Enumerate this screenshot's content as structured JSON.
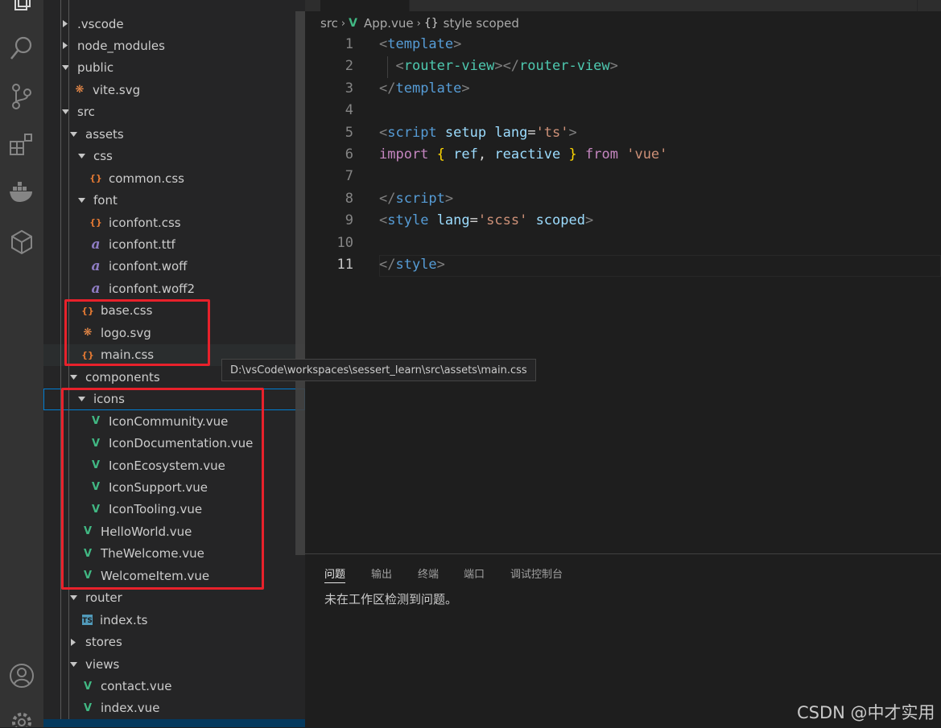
{
  "explorer": {
    "items": [
      {
        "label": ".vscode",
        "kind": "folder",
        "expanded": false,
        "depth": 0
      },
      {
        "label": "node_modules",
        "kind": "folder",
        "expanded": false,
        "depth": 0
      },
      {
        "label": "public",
        "kind": "folder",
        "expanded": true,
        "depth": 0
      },
      {
        "label": "vite.svg",
        "kind": "svg",
        "depth": 1
      },
      {
        "label": "src",
        "kind": "folder",
        "expanded": true,
        "depth": 0
      },
      {
        "label": "assets",
        "kind": "folder",
        "expanded": true,
        "depth": 1
      },
      {
        "label": "css",
        "kind": "folder",
        "expanded": true,
        "depth": 2
      },
      {
        "label": "common.css",
        "kind": "css",
        "depth": 3
      },
      {
        "label": "font",
        "kind": "folder",
        "expanded": true,
        "depth": 2
      },
      {
        "label": "iconfont.css",
        "kind": "css",
        "depth": 3
      },
      {
        "label": "iconfont.ttf",
        "kind": "font",
        "depth": 3
      },
      {
        "label": "iconfont.woff",
        "kind": "font",
        "depth": 3
      },
      {
        "label": "iconfont.woff2",
        "kind": "font",
        "depth": 3
      },
      {
        "label": "base.css",
        "kind": "css",
        "depth": 2
      },
      {
        "label": "logo.svg",
        "kind": "svg",
        "depth": 2
      },
      {
        "label": "main.css",
        "kind": "css",
        "depth": 2
      },
      {
        "label": "components",
        "kind": "folder",
        "expanded": true,
        "depth": 1
      },
      {
        "label": "icons",
        "kind": "folder",
        "expanded": true,
        "depth": 2
      },
      {
        "label": "IconCommunity.vue",
        "kind": "vue",
        "depth": 3
      },
      {
        "label": "IconDocumentation.vue",
        "kind": "vue",
        "depth": 3
      },
      {
        "label": "IconEcosystem.vue",
        "kind": "vue",
        "depth": 3
      },
      {
        "label": "IconSupport.vue",
        "kind": "vue",
        "depth": 3
      },
      {
        "label": "IconTooling.vue",
        "kind": "vue",
        "depth": 3
      },
      {
        "label": "HelloWorld.vue",
        "kind": "vue",
        "depth": 2
      },
      {
        "label": "TheWelcome.vue",
        "kind": "vue",
        "depth": 2
      },
      {
        "label": "WelcomeItem.vue",
        "kind": "vue",
        "depth": 2
      },
      {
        "label": "router",
        "kind": "folder",
        "expanded": true,
        "depth": 1
      },
      {
        "label": "index.ts",
        "kind": "ts",
        "depth": 2
      },
      {
        "label": "stores",
        "kind": "folder",
        "expanded": false,
        "depth": 1
      },
      {
        "label": "views",
        "kind": "folder",
        "expanded": true,
        "depth": 1
      },
      {
        "label": "contact.vue",
        "kind": "vue",
        "depth": 2
      },
      {
        "label": "index.vue",
        "kind": "vue",
        "depth": 2
      }
    ],
    "icon_glyphs": {
      "css": "{}",
      "svg": "❋",
      "font": "a",
      "vue": "V",
      "ts": "TS"
    },
    "icon_colors": {
      "css": "#e37933",
      "svg": "#f08d49",
      "font": "#8e7cc3",
      "vue": "#41b883",
      "ts": "#519aba"
    }
  },
  "tooltip": "D:\\vsCode\\workspaces\\sessert_learn\\src\\assets\\main.css",
  "breadcrumb": {
    "folder": "src",
    "file": "App.vue",
    "symbol": "style scoped",
    "file_icon": "V",
    "symbol_icon": "{}"
  },
  "editor": {
    "lines": [
      {
        "n": "1",
        "tokens": [
          [
            "t-punc",
            "<"
          ],
          [
            "t-tag",
            "template"
          ],
          [
            "t-punc",
            ">"
          ]
        ]
      },
      {
        "n": "2",
        "tokens": [
          [
            "t-txt",
            "  "
          ],
          [
            "t-punc",
            "<"
          ],
          [
            "t-tag2",
            "router-view"
          ],
          [
            "t-punc",
            "></"
          ],
          [
            "t-tag2",
            "router-view"
          ],
          [
            "t-punc",
            ">"
          ]
        ]
      },
      {
        "n": "3",
        "tokens": [
          [
            "t-punc",
            "</"
          ],
          [
            "t-tag",
            "template"
          ],
          [
            "t-punc",
            ">"
          ]
        ]
      },
      {
        "n": "4",
        "tokens": []
      },
      {
        "n": "5",
        "tokens": [
          [
            "t-punc",
            "<"
          ],
          [
            "t-tag",
            "script"
          ],
          [
            "t-txt",
            " "
          ],
          [
            "t-attr",
            "setup"
          ],
          [
            "t-txt",
            " "
          ],
          [
            "t-attr",
            "lang"
          ],
          [
            "t-txt",
            "="
          ],
          [
            "t-str",
            "'ts'"
          ],
          [
            "t-punc",
            ">"
          ]
        ]
      },
      {
        "n": "6",
        "tokens": [
          [
            "t-kw",
            "import"
          ],
          [
            "t-txt",
            " "
          ],
          [
            "t-brace",
            "{"
          ],
          [
            "t-txt",
            " "
          ],
          [
            "t-var",
            "ref"
          ],
          [
            "t-txt",
            ", "
          ],
          [
            "t-var",
            "reactive"
          ],
          [
            "t-txt",
            " "
          ],
          [
            "t-brace",
            "}"
          ],
          [
            "t-txt",
            " "
          ],
          [
            "t-kw",
            "from"
          ],
          [
            "t-txt",
            " "
          ],
          [
            "t-str",
            "'vue'"
          ]
        ]
      },
      {
        "n": "7",
        "tokens": []
      },
      {
        "n": "8",
        "tokens": [
          [
            "t-punc",
            "</"
          ],
          [
            "t-tag",
            "script"
          ],
          [
            "t-punc",
            ">"
          ]
        ]
      },
      {
        "n": "9",
        "tokens": [
          [
            "t-punc",
            "<"
          ],
          [
            "t-tag",
            "style"
          ],
          [
            "t-txt",
            " "
          ],
          [
            "t-attr",
            "lang"
          ],
          [
            "t-txt",
            "="
          ],
          [
            "t-str",
            "'scss'"
          ],
          [
            "t-txt",
            " "
          ],
          [
            "t-attr",
            "scoped"
          ],
          [
            "t-punc",
            ">"
          ]
        ]
      },
      {
        "n": "10",
        "tokens": []
      },
      {
        "n": "11",
        "tokens": [
          [
            "t-punc",
            "</"
          ],
          [
            "t-tag",
            "style"
          ],
          [
            "t-punc",
            ">"
          ]
        ]
      }
    ],
    "current_line": "11"
  },
  "panel": {
    "tabs": [
      "问题",
      "输出",
      "终端",
      "端口",
      "调试控制台"
    ],
    "active_tab": "问题",
    "message": "未在工作区检测到问题。"
  },
  "watermark": "CSDN @中才实用",
  "colors": {
    "annotation_red": "#e8212b",
    "focus_blue": "#007fd4"
  }
}
